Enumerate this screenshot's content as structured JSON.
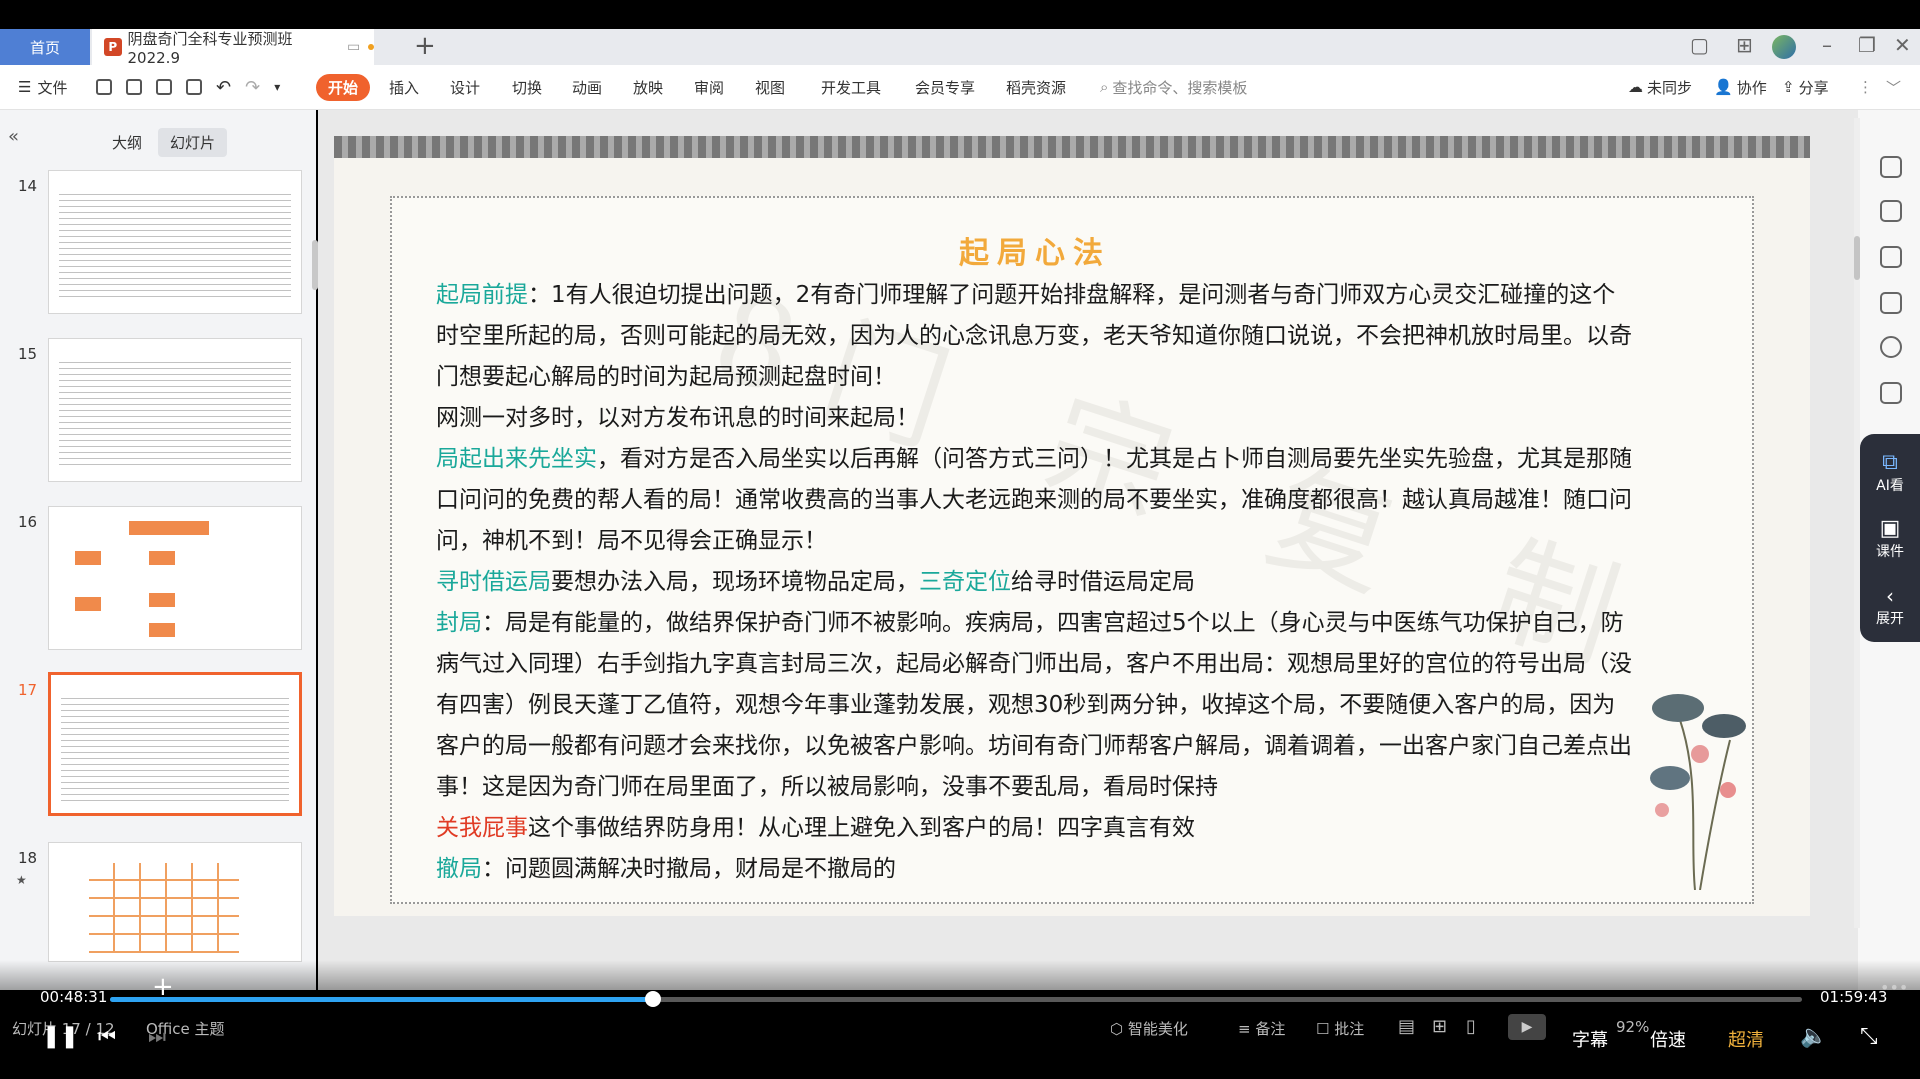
{
  "tabs": {
    "home_label": "首页",
    "doc_title": "阴盘奇门全科专业预测班2022.9"
  },
  "ribbon": {
    "file": "文件",
    "items": [
      "开始",
      "插入",
      "设计",
      "切换",
      "动画",
      "放映",
      "审阅",
      "视图",
      "开发工具",
      "会员专享",
      "稻壳资源"
    ],
    "search_placeholder": "查找命令、搜索模板",
    "sync": "未同步",
    "collab": "协作",
    "share": "分享"
  },
  "left_panel": {
    "tab_outline": "大纲",
    "tab_slides": "幻灯片",
    "thumbnails": [
      {
        "num": "14"
      },
      {
        "num": "15"
      },
      {
        "num": "16"
      },
      {
        "num": "17",
        "selected": true
      },
      {
        "num": "18"
      }
    ]
  },
  "slide": {
    "title": "起局心法",
    "p1_label": "起局前提",
    "p1_text": "：1有人很迫切提出问题，2有奇门师理解了问题开始排盘解释，是问测者与奇门师双方心灵交汇碰撞的这个时空里所起的局，否则可能起的局无效，因为人的心念讯息万变，老天爷知道你随口说说，不会把神机放时局里。以奇门想要起心解局的时间为起局预测起盘时间！",
    "p2_text": "网测一对多时，以对方发布讯息的时间来起局！",
    "p3_label": "局起出来先坐实",
    "p3_text": "，看对方是否入局坐实以后再解（问答方式三问）！尤其是占卜师自测局要先坐实先验盘，尤其是那随口问问的免费的帮人看的局！通常收费高的当事人大老远跑来测的局不要坐实，准确度都很高！越认真局越准！随口问问，神机不到！局不见得会正确显示！",
    "p4_label": "寻时借运局",
    "p4_text_a": "要想办法入局，现场环境物品定局，",
    "p4_label_b": "三奇定位",
    "p4_text_b": "给寻时借运局定局",
    "p5_label": "封局",
    "p5_text": "：局是有能量的，做结界保护奇门师不被影响。疾病局，四害宫超过5个以上（身心灵与中医练气功保护自己，防病气过入同理）右手剑指九字真言封局三次，起局必解奇门师出局，客户不用出局：观想局里好的宫位的符号出局（没有四害）例艮天蓬丁乙值符，观想今年事业蓬勃发展，观想30秒到两分钟，收掉这个局，不要随便入客户的局，因为客户的局一般都有问题才会来找你，以免被客户影响。坊间有奇门师帮客户解局，调着调着，一出客户家门自己差点出事！这是因为奇门师在局里面了，所以被局影响，没事不要乱局，看局时保持",
    "p6_label": "关我屁事",
    "p6_text": "这个事做结界防身用！从心理上避免入到客户的局！四字真言有效",
    "p7_label": "撤局",
    "p7_text": "：问题圆满解决时撤局，财局是不撤局的"
  },
  "right_bar": {
    "ai_label": "AI看",
    "courseware_label": "课件",
    "expand_label": "展开"
  },
  "player": {
    "current_time": "00:48:31",
    "total_time": "01:59:43",
    "progress": 0.321,
    "subtitle": "字幕",
    "speed": "倍速",
    "quality": "超清"
  },
  "statusbar": {
    "slide_info": "幻灯片 17 / 12",
    "theme": "Office 主题",
    "beautify": "智能美化",
    "notes": "备注",
    "comments": "批注",
    "zoom": "92%"
  },
  "colors": {
    "accent_orange": "#f0622d",
    "green_label": "#1aa89a",
    "red_label": "#e03b24",
    "title_gold": "#f2a93b",
    "progress_blue": "#2ea3f2"
  }
}
